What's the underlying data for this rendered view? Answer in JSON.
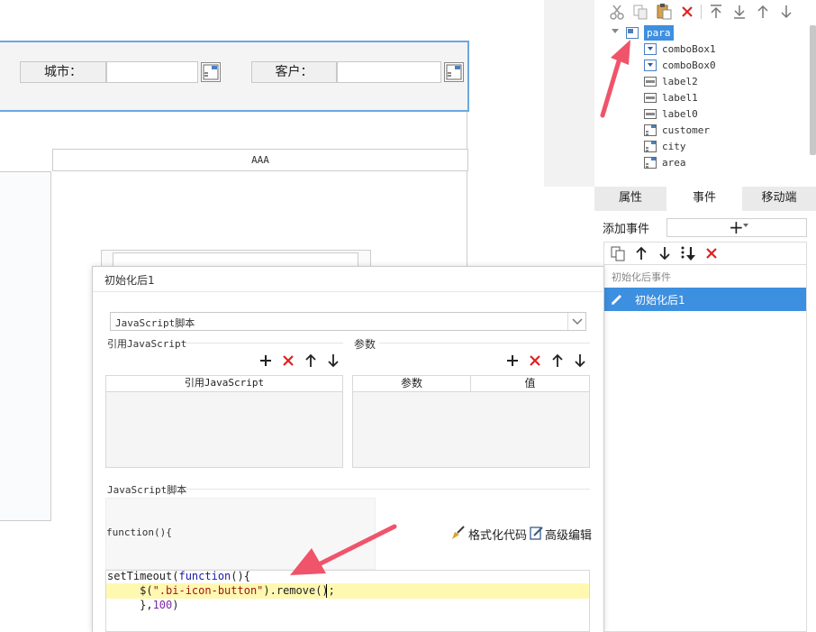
{
  "param_panel": {
    "city_label": "城市：",
    "customer_label": "客户："
  },
  "canvas": {
    "column_header": "AAA"
  },
  "tree": {
    "items": [
      {
        "label": "para",
        "icon": "form-icon",
        "selected": true
      },
      {
        "label": "comboBox1",
        "icon": "combobox-icon"
      },
      {
        "label": "comboBox0",
        "icon": "combobox-icon"
      },
      {
        "label": "label2",
        "icon": "label-icon"
      },
      {
        "label": "label1",
        "icon": "label-icon"
      },
      {
        "label": "label0",
        "icon": "label-icon"
      },
      {
        "label": "customer",
        "icon": "widget-icon"
      },
      {
        "label": "city",
        "icon": "widget-icon"
      },
      {
        "label": "area",
        "icon": "widget-icon"
      }
    ]
  },
  "tabs": [
    {
      "label": "属性"
    },
    {
      "label": "事件",
      "active": true
    },
    {
      "label": "移动端"
    }
  ],
  "events": {
    "add_label": "添加事件",
    "add_button": "+",
    "group_label": "初始化后事件",
    "items": [
      {
        "label": "初始化后1",
        "selected": true
      }
    ]
  },
  "dialog": {
    "title": "初始化后1",
    "type_value": "JavaScript脚本",
    "ref_js_label": "引用JavaScript",
    "params_label": "参数",
    "ref_js_header": "引用JavaScript",
    "param_header": "参数",
    "value_header": "值",
    "script_label": "JavaScript脚本",
    "fn_signature": "function(){",
    "format_button": "格式化代码",
    "advanced_button": "高级编辑"
  },
  "code": {
    "l1_a": "setTimeout(",
    "l1_kw": "function",
    "l1_b": "(){",
    "l2_a": "     $(",
    "l2_str": "\".bi-icon-button\"",
    "l2_b": ").remove();",
    "l3_a": "     },",
    "l3_num": "100",
    "l3_b": ")"
  },
  "colors": {
    "accent": "#3d8fe0",
    "panel_border": "#6ba7e0",
    "arrow": "#f0546a",
    "delete_red": "#e02020"
  }
}
